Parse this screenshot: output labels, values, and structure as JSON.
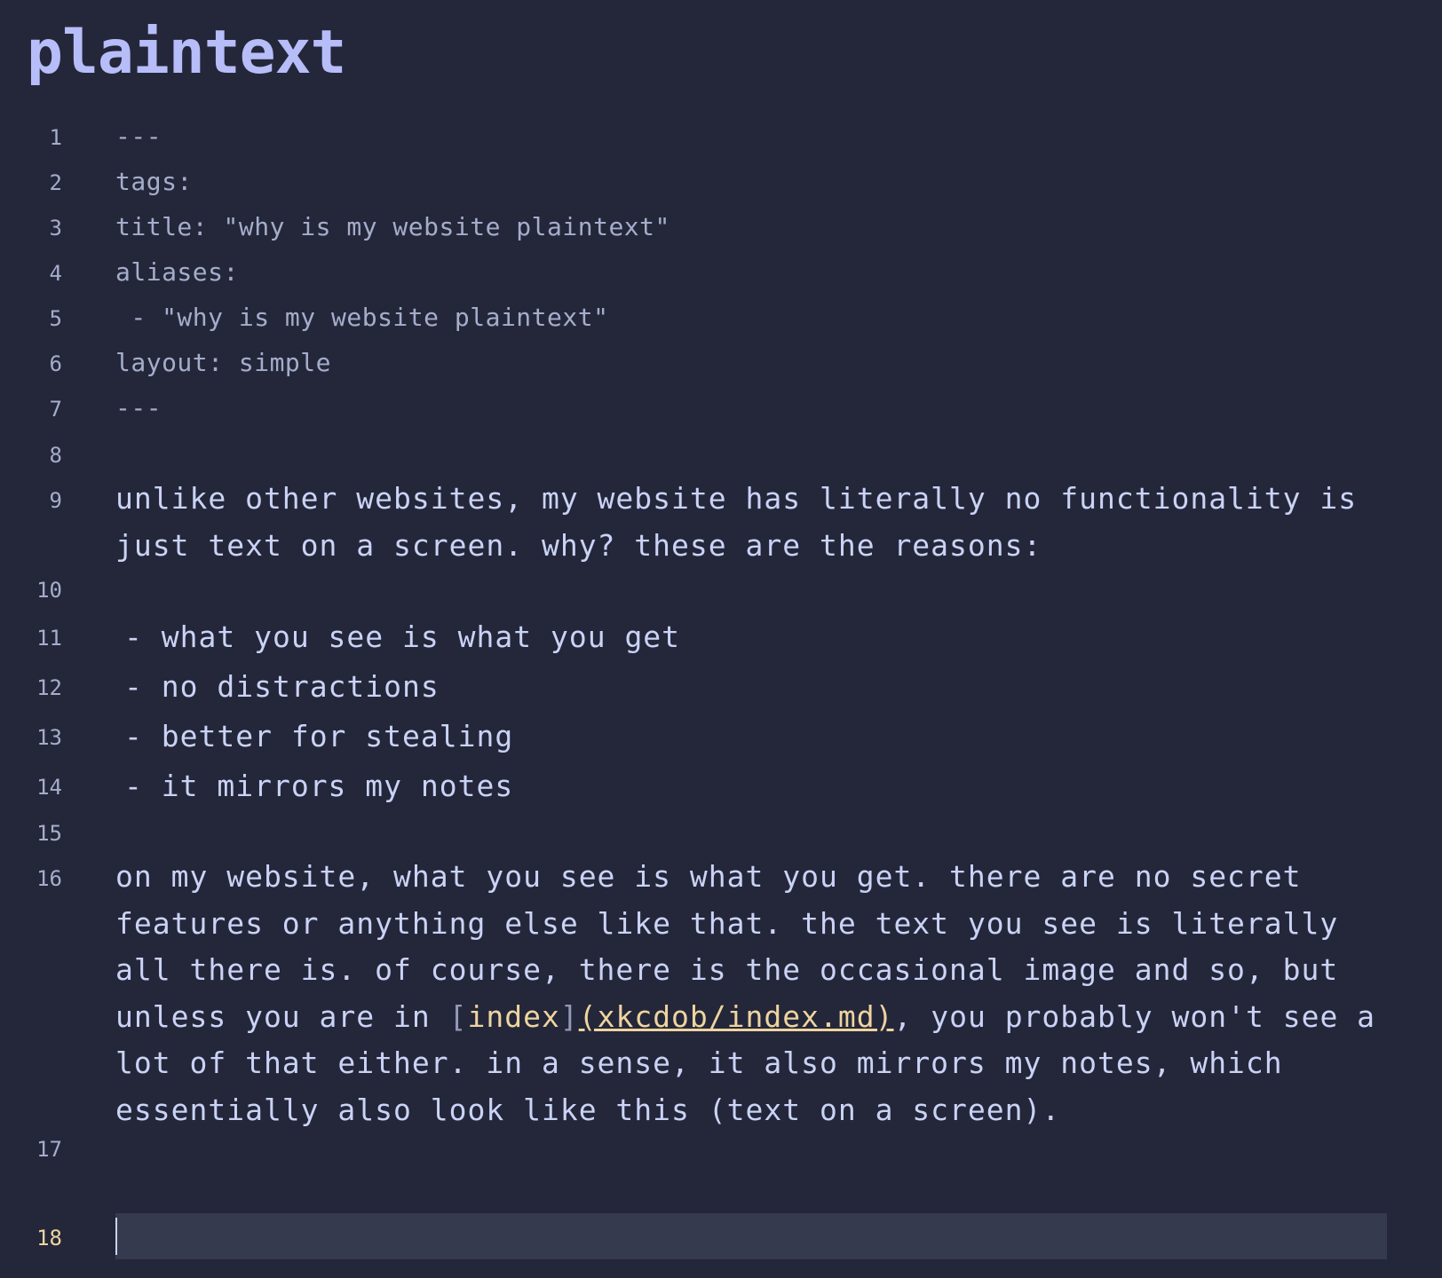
{
  "page": {
    "title": "plaintext"
  },
  "editor": {
    "lines": [
      {
        "n": "1",
        "text": "---"
      },
      {
        "n": "2",
        "text": "tags:"
      },
      {
        "n": "3",
        "text": "title: \"why is my website plaintext\""
      },
      {
        "n": "4",
        "text": "aliases:"
      },
      {
        "n": "5",
        "text": " - \"why is my website plaintext\""
      },
      {
        "n": "6",
        "text": "layout: simple"
      },
      {
        "n": "7",
        "text": "---"
      },
      {
        "n": "8",
        "text": ""
      },
      {
        "n": "9",
        "text": "unlike other websites, my website has literally no functionality is just text on a screen. why? these are the reasons:"
      },
      {
        "n": "10",
        "text": ""
      },
      {
        "n": "11",
        "dash": "- ",
        "text": "what you see is what you get"
      },
      {
        "n": "12",
        "dash": "- ",
        "text": "no distractions"
      },
      {
        "n": "13",
        "dash": "- ",
        "text": "better for stealing"
      },
      {
        "n": "14",
        "dash": "- ",
        "text": "it mirrors my notes"
      },
      {
        "n": "15",
        "text": ""
      },
      {
        "n": "16",
        "text_before": "on my website, what you see is what you get. there are no secret features or anything else like that. the text you see is literally all there is. of course, there is the occasional image and so, but unless you are in ",
        "link_open": "[",
        "link_text": "index",
        "link_close": "]",
        "link_url": "(xkcdob/index.md)",
        "text_after": ", you probably won't see a lot of that either. in a sense, it also mirrors my notes, which essentially also look like this (text on a screen)."
      },
      {
        "n": "17",
        "text": ""
      },
      {
        "n": "18",
        "text": ""
      }
    ]
  },
  "colors": {
    "background": "#24273a",
    "title": "#b7bdf8",
    "text": "#cad3f5",
    "muted": "#a5adcb",
    "link": "#eed49f",
    "active_line_number": "#eed49f",
    "current_line_bg": "#363a4f"
  }
}
